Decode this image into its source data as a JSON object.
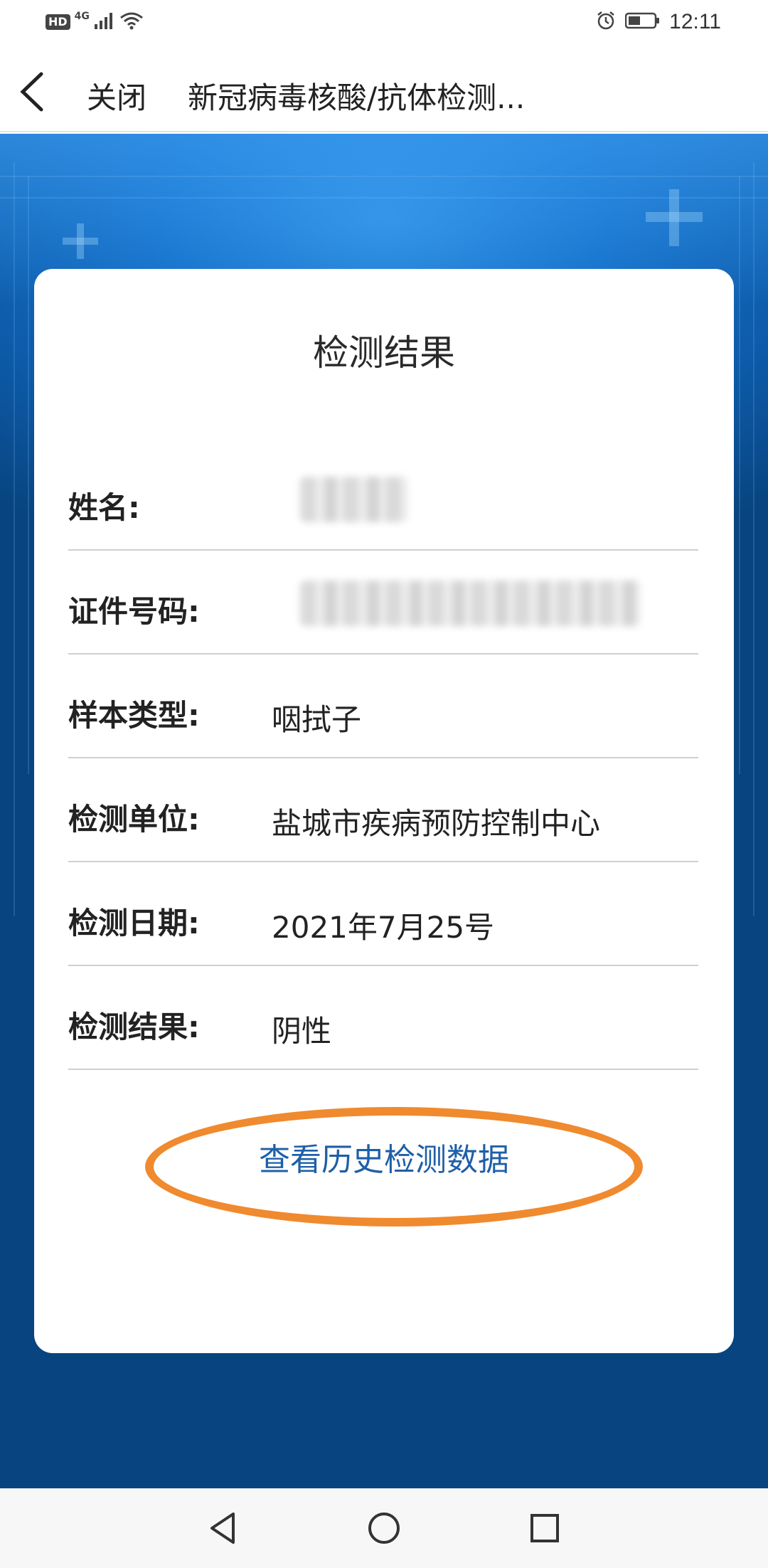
{
  "status_bar": {
    "hd": "HD",
    "network": "4G",
    "time": "12:11"
  },
  "nav": {
    "close_label": "关闭",
    "title": "新冠病毒核酸/抗体检测..."
  },
  "card": {
    "title": "检测结果",
    "rows": [
      {
        "label": "姓名:",
        "value": ""
      },
      {
        "label": "证件号码:",
        "value": ""
      },
      {
        "label": "样本类型:",
        "value": "咽拭子"
      },
      {
        "label": "检测单位:",
        "value": "盐城市疾病预防控制中心"
      },
      {
        "label": "检测日期:",
        "value": "2021年7月25号"
      },
      {
        "label": "检测结果:",
        "value": "阴性"
      }
    ],
    "history_link": "查看历史检测数据"
  },
  "colors": {
    "accent_link": "#1e5fa8",
    "highlight_oval": "#f08a2e",
    "background_blue": "#0d5aa8"
  },
  "icons": {
    "back": "chevron-left-icon",
    "alarm": "alarm-icon",
    "battery": "battery-icon",
    "wifi": "wifi-icon",
    "signal": "signal-icon",
    "sys_back": "triangle-back-icon",
    "sys_home": "circle-home-icon",
    "sys_recent": "square-recent-icon"
  }
}
